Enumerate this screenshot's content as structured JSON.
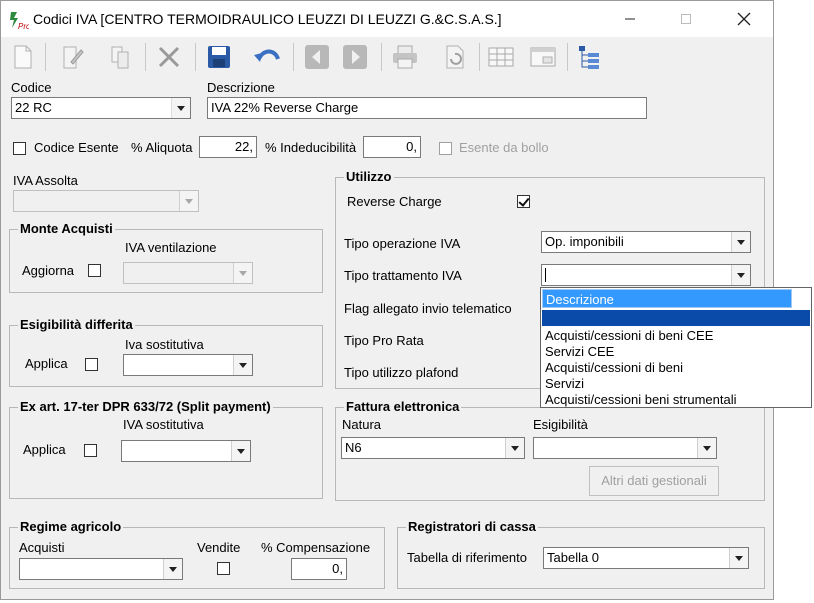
{
  "window": {
    "title": "Codici IVA [CENTRO TERMOIDRAULICO LEUZZI DI LEUZZI G.&C.S.A.S.]",
    "app_badge": "Pro"
  },
  "fields": {
    "codice_label": "Codice",
    "codice_value": "22 RC",
    "descrizione_label": "Descrizione",
    "descrizione_value": "IVA 22% Reverse Charge",
    "codice_esente_label": "Codice Esente",
    "aliquota_label": "% Aliquota",
    "aliquota_value": "22,",
    "indeducibilita_label": "% Indeducibilità",
    "indeducibilita_value": "0,",
    "esente_bollo_label": "Esente da bollo",
    "iva_assolta_label": "IVA Assolta"
  },
  "monte_acquisti": {
    "caption": "Monte Acquisti",
    "iva_ventilazione_label": "IVA ventilazione",
    "aggiorna_label": "Aggiorna"
  },
  "esigibilita_differita": {
    "caption": "Esigibilità differita",
    "iva_sostitutiva_label": "Iva sostitutiva",
    "applica_label": "Applica"
  },
  "split_payment": {
    "caption": "Ex art. 17-ter DPR 633/72 (Split payment)",
    "iva_sostitutiva_label": "IVA sostitutiva",
    "applica_label": "Applica"
  },
  "utilizzo": {
    "caption": "Utilizzo",
    "reverse_charge_label": "Reverse Charge",
    "reverse_charge_checked": true,
    "tipo_operazione_label": "Tipo operazione IVA",
    "tipo_operazione_value": "Op. imponibili",
    "tipo_trattamento_label": "Tipo trattamento IVA",
    "tipo_trattamento_value": "",
    "flag_allegato_label": "Flag allegato invio telematico",
    "tipo_pro_rata_label": "Tipo Pro Rata",
    "tipo_plafond_label": "Tipo utilizzo plafond"
  },
  "dropdown": {
    "header": "Descrizione",
    "items": [
      "Acquisti/cessioni di beni CEE",
      "Servizi CEE",
      "Acquisti/cessioni di beni",
      "Servizi",
      "Acquisti/cessioni beni strumentali"
    ]
  },
  "fattura_elettronica": {
    "caption": "Fattura elettronica",
    "natura_label": "Natura",
    "natura_value": "N6",
    "esigibilita_label": "Esigibilità",
    "altri_dati_label": "Altri dati gestionali"
  },
  "regime_agricolo": {
    "caption": "Regime agricolo",
    "acquisti_label": "Acquisti",
    "vendite_label": "Vendite",
    "compensazione_label": "% Compensazione",
    "compensazione_value": "0,"
  },
  "registratori": {
    "caption": "Registratori  di cassa",
    "tabella_label": "Tabella di riferimento",
    "tabella_value": "Tabella 0"
  },
  "colors": {
    "accent": "#3399ff",
    "selection": "#0a4aa8",
    "save_blue": "#2a5aa6"
  }
}
